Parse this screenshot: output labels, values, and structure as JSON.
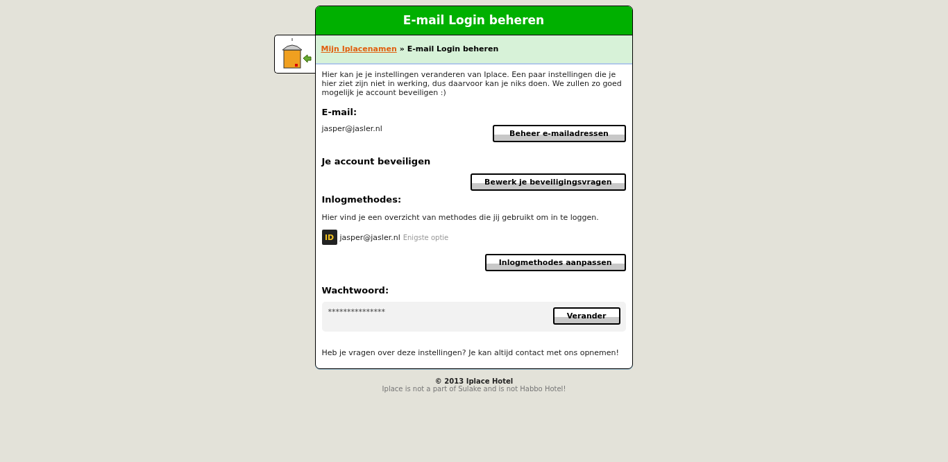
{
  "header": {
    "title": "E-mail Login beheren"
  },
  "breadcrumb": {
    "link": "Mijn Iplacenamen",
    "separator": "»",
    "current": "E-mail Login beheren"
  },
  "intro": "Hier kan je je instellingen veranderen van Iplace. Een paar instellingen die je hier ziet zijn niet in werking, dus daarvoor kan je niks doen. We zullen zo goed mogelijk je account beveiligen :)",
  "email": {
    "heading": "E-mail:",
    "address": "jasper@jasler.nl",
    "button": "Beheer e-mailadressen"
  },
  "security": {
    "heading": "Je account beveiligen",
    "button": "Bewerk je beveiligingsvragen"
  },
  "login_methods": {
    "heading": "Inlogmethodes:",
    "description": "Hier vind je een overzicht van methodes die jij gebruikt om in te loggen.",
    "methods": [
      {
        "badge": "ID",
        "address": "jasper@jasler.nl",
        "note": "Enigste optie"
      }
    ],
    "button": "Inlogmethodes aanpassen"
  },
  "password": {
    "heading": "Wachtwoord:",
    "masked": "***************",
    "button": "Verander"
  },
  "contact": "Heb je vragen over deze instellingen? Je kan altijd contact met ons opnemen!",
  "footer": {
    "copyright": "© 2013 Iplace Hotel",
    "disclaimer": "Iplace is not a part of Sulake and is not Habbo Hotel!"
  }
}
